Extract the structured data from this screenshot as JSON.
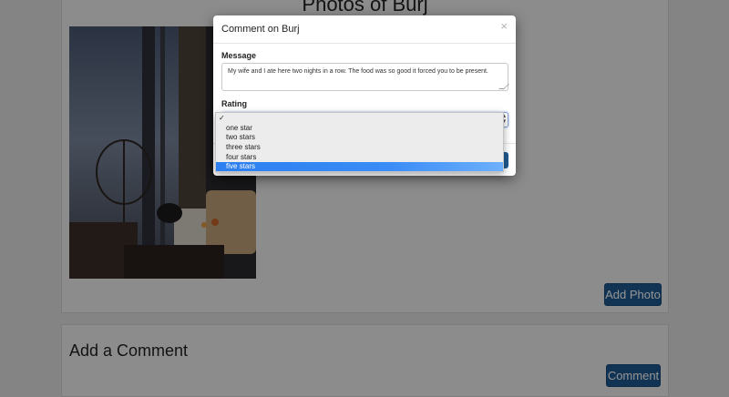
{
  "page": {
    "photos_title": "Photos of Burj",
    "add_photo_label": "Add Photo",
    "add_comment_title": "Add a Comment",
    "comment_button_label": "Comment"
  },
  "modal": {
    "title": "Comment on Burj",
    "close_glyph": "×",
    "message_label": "Message",
    "message_value": "My wife and I ate here two nights in a row. The food was so good it forced you to be present.",
    "rating_label": "Rating",
    "rating_selected": "five stars"
  },
  "rating_options": [
    {
      "label": "",
      "checked": true
    },
    {
      "label": "one star",
      "checked": false
    },
    {
      "label": "two stars",
      "checked": false
    },
    {
      "label": "three stars",
      "checked": false
    },
    {
      "label": "four stars",
      "checked": false
    },
    {
      "label": "five stars",
      "checked": false,
      "highlighted": true
    }
  ],
  "icons": {
    "check": "✓",
    "select_arrows": "▴▾"
  },
  "colors": {
    "primary": "#1f5a92",
    "highlight": "#2d7ff0"
  }
}
